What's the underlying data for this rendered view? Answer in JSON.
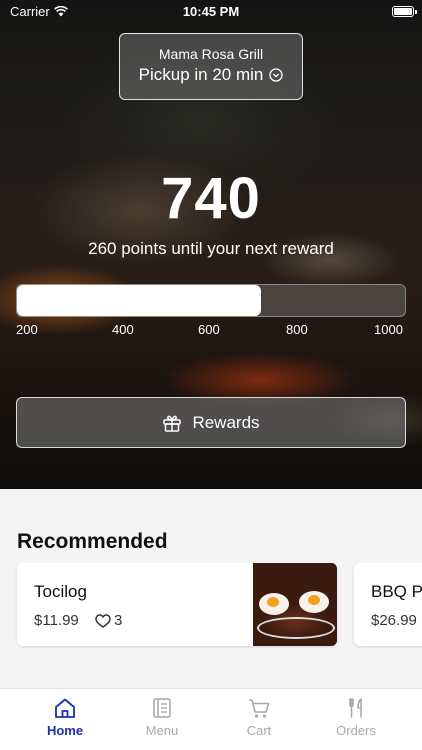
{
  "status_bar": {
    "carrier": "Carrier",
    "time": "10:45 PM"
  },
  "location": {
    "name": "Mama Rosa Grill",
    "pickup": "Pickup in 20 min"
  },
  "points": {
    "value": "740",
    "caption": "260 points until your next reward",
    "progress_fraction": 0.63,
    "ticks": [
      "200",
      "400",
      "600",
      "800",
      "1000"
    ]
  },
  "rewards_button": {
    "label": "Rewards"
  },
  "recommended": {
    "title": "Recommended",
    "items": [
      {
        "name": "Tocilog",
        "price": "$11.99",
        "likes": "3"
      },
      {
        "name": "BBQ Pr",
        "price": "$26.99"
      }
    ]
  },
  "tabs": [
    {
      "label": "Home",
      "active": true
    },
    {
      "label": "Menu"
    },
    {
      "label": "Cart"
    },
    {
      "label": "Orders"
    }
  ],
  "colors": {
    "accent": "#1a2fb5",
    "inactive_tab": "#a9a9a9"
  }
}
